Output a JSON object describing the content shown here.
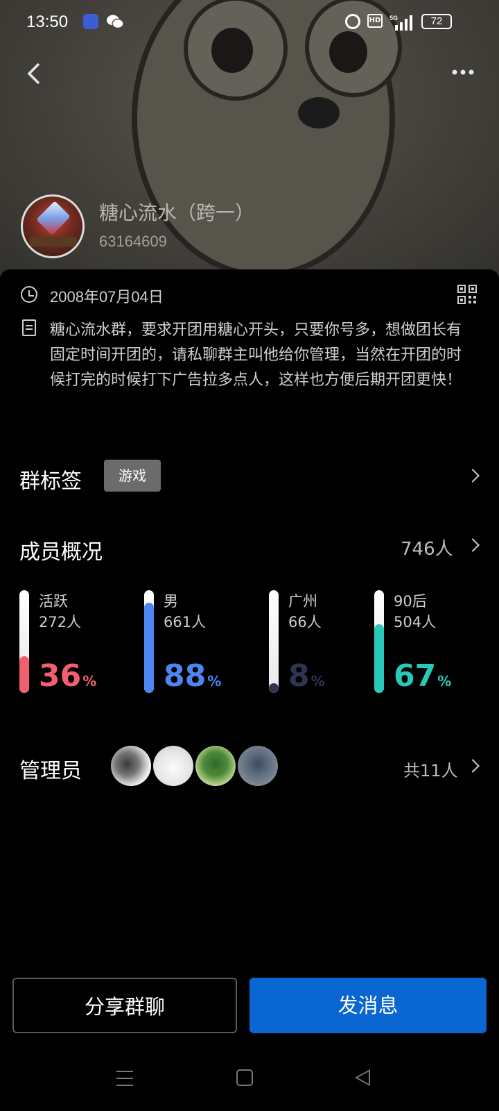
{
  "status_bar": {
    "time": "13:50",
    "battery": "72",
    "network": "5G",
    "hd": "HD"
  },
  "header": {
    "group_name": "糖心流水（跨一）",
    "group_id": "63164609"
  },
  "info": {
    "created_date": "2008年07月04日",
    "description": "糖心流水群，要求开团用糖心开头，只要你号多，想做团长有固定时间开团的，请私聊群主叫他给你管理，当然在开团的时候打完的时候打下广告拉多点人，这样也方便后期开团更快！"
  },
  "tags": {
    "title": "群标签",
    "items": [
      "游戏"
    ]
  },
  "members": {
    "title": "成员概况",
    "count": "746人",
    "stats": [
      {
        "label": "活跃",
        "count": "272人",
        "percent": "36",
        "unit": "%",
        "fraction": 0.36,
        "color": "#f0606e"
      },
      {
        "label": "男",
        "count": "661人",
        "percent": "88",
        "unit": "%",
        "fraction": 0.88,
        "color": "#4d86f0"
      },
      {
        "label": "广州",
        "count": "66人",
        "percent": "8",
        "unit": "%",
        "fraction": 0.08,
        "color": "#2e3550"
      },
      {
        "label": "90后",
        "count": "504人",
        "percent": "67",
        "unit": "%",
        "fraction": 0.67,
        "color": "#28c9b8"
      }
    ]
  },
  "admins": {
    "title": "管理员",
    "count": "共11人"
  },
  "actions": {
    "share": "分享群聊",
    "send": "发消息"
  },
  "colors": {
    "primary_button": "#0a66d1",
    "background": "#000000"
  }
}
